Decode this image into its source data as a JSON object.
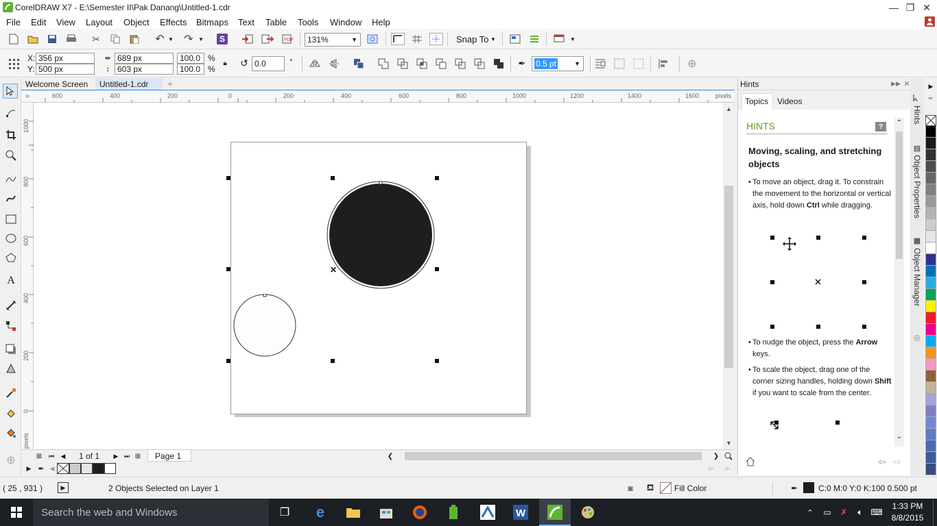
{
  "window": {
    "title": "CorelDRAW X7 - E:\\Semester II\\Pak Danang\\Untitled-1.cdr"
  },
  "menu": [
    "File",
    "Edit",
    "View",
    "Layout",
    "Object",
    "Effects",
    "Bitmaps",
    "Text",
    "Table",
    "Tools",
    "Window",
    "Help"
  ],
  "standard_toolbar": {
    "zoom": "131%",
    "snap_to": "Snap To"
  },
  "property_bar": {
    "x_label": "X:",
    "x": "356 px",
    "y_label": "Y:",
    "y": "500 px",
    "width": "689 px",
    "height": "603 px",
    "scale_w": "100.0",
    "scale_h": "100.0",
    "percent": "%",
    "rotation": "0.0",
    "degree": "°",
    "outline_width": "0.5 pt"
  },
  "doc_tabs": [
    "Welcome Screen",
    "Untitled-1.cdr"
  ],
  "ruler": {
    "unit": "pixels",
    "h_ticks": [
      "600",
      "400",
      "200",
      "0",
      "200",
      "400",
      "600",
      "800",
      "1000",
      "1200",
      "1400",
      "1600"
    ],
    "v_ticks": [
      "1000",
      "800",
      "600",
      "400",
      "200",
      "0"
    ]
  },
  "page_nav": {
    "page_count": "1 of 1",
    "page_tab": "Page 1"
  },
  "hints": {
    "panel_title": "Hints",
    "tabs": [
      "Topics",
      "Videos"
    ],
    "heading": "HINTS",
    "topic": "Moving, scaling, and stretching objects",
    "p1_a": "To move an object, drag it. To constrain the movement to the horizontal or vertical axis, hold down ",
    "p1_key": "Ctrl",
    "p1_b": " while dragging.",
    "p2_a": "To nudge the object, press the ",
    "p2_key": "Arrow",
    "p2_b": " keys.",
    "p3_a": "To scale the object, drag one of the corner sizing handles, holding down ",
    "p3_key": "Shift",
    "p3_b": " if you want to scale from the center."
  },
  "docker_tabs": [
    "Hints",
    "Object Properties",
    "Object Manager"
  ],
  "palette_colors": [
    "#000000",
    "#1a1a1a",
    "#333333",
    "#4d4d4d",
    "#666666",
    "#808080",
    "#999999",
    "#b3b3b3",
    "#cccccc",
    "#e6e6e6",
    "#ffffff",
    "#2e3192",
    "#0071bc",
    "#29abe2",
    "#00a651",
    "#fff200",
    "#ed1c24",
    "#ec008c",
    "#00aeef",
    "#f7941d",
    "#f49ac1",
    "#8c6239",
    "#c7b299",
    "#a3a3d9",
    "#8080c0",
    "#6e8cd5",
    "#5a7ec8",
    "#4a6bb3",
    "#3f5a9a",
    "#334d80"
  ],
  "status": {
    "cursor": "( 25 , 931 )",
    "selection": "2 Objects Selected on Layer 1",
    "fill": "Fill Color",
    "outline": "C:0 M:0 Y:0 K:100  0.500 pt"
  },
  "taskbar": {
    "search_placeholder": "Search the web and Windows",
    "time": "1:33 PM",
    "date": "8/8/2015"
  },
  "icons": {
    "black": "#000000",
    "accent": "#3a6fd8",
    "corel_green": "#5cb531",
    "hint_green": "#6a9a24"
  }
}
